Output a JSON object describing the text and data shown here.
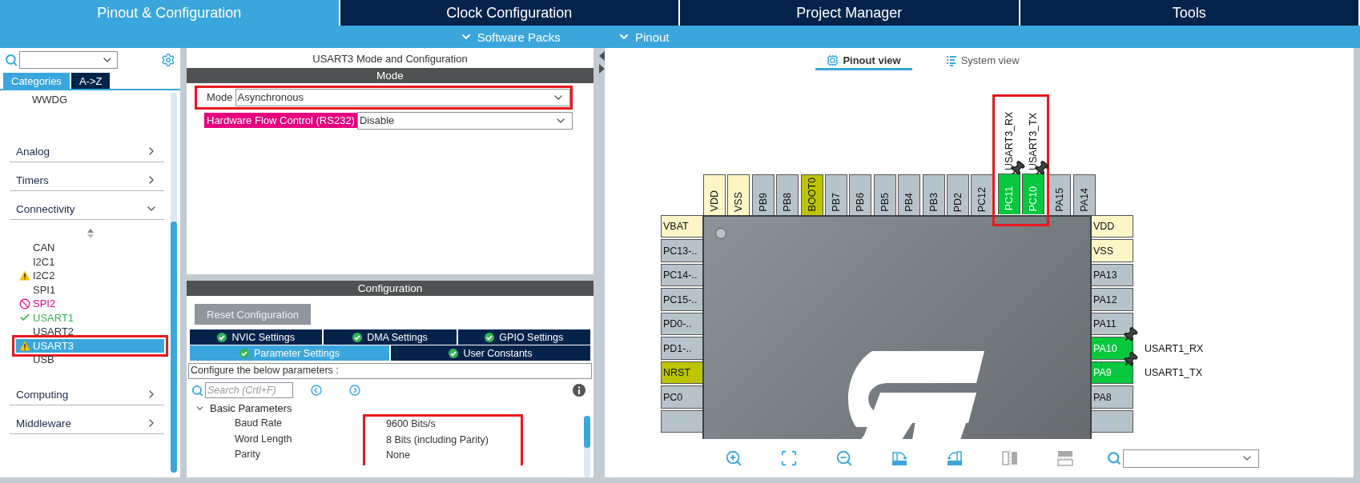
{
  "main_tabs": [
    {
      "label": "Pinout & Configuration",
      "selected": true
    },
    {
      "label": "Clock Configuration",
      "selected": false
    },
    {
      "label": "Project Manager",
      "selected": false
    },
    {
      "label": "Tools",
      "selected": false
    }
  ],
  "sub_menus": [
    "Software Packs",
    "Pinout"
  ],
  "sidebar": {
    "tabs": [
      {
        "label": "Categories",
        "selected": true
      },
      {
        "label": "A->Z",
        "selected": false
      }
    ],
    "top_items": [
      "WWDG"
    ],
    "categories": [
      {
        "label": "Analog",
        "expanded": false
      },
      {
        "label": "Timers",
        "expanded": false
      },
      {
        "label": "Connectivity",
        "expanded": true,
        "children": [
          {
            "label": "CAN",
            "kind": "plain",
            "selected": false,
            "annotated": false
          },
          {
            "label": "I2C1",
            "kind": "plain",
            "selected": false,
            "annotated": false
          },
          {
            "label": "I2C2",
            "kind": "warning",
            "selected": false,
            "annotated": false
          },
          {
            "label": "SPI1",
            "kind": "plain",
            "selected": false,
            "annotated": false
          },
          {
            "label": "SPI2",
            "kind": "error",
            "selected": false,
            "annotated": false
          },
          {
            "label": "USART1",
            "kind": "ok",
            "selected": false,
            "annotated": false
          },
          {
            "label": "USART2",
            "kind": "plain",
            "selected": false,
            "annotated": false
          },
          {
            "label": "USART3",
            "kind": "warning",
            "selected": true,
            "annotated": true
          },
          {
            "label": "USB",
            "kind": "plain",
            "selected": false,
            "annotated": false
          }
        ]
      },
      {
        "label": "Computing",
        "expanded": false
      },
      {
        "label": "Middleware",
        "expanded": false
      }
    ]
  },
  "mode_panel": {
    "title": "USART3 Mode and Configuration",
    "header": "Mode",
    "fields": [
      {
        "label": "Mode",
        "value": "Asynchronous",
        "flagged": false,
        "annotated": true
      },
      {
        "label": "Hardware Flow Control (RS232)",
        "value": "Disable",
        "flagged": true
      }
    ]
  },
  "config_panel": {
    "header": "Configuration",
    "reset_button": {
      "label": "Reset Configuration",
      "disabled": true
    },
    "tab_rows": [
      [
        {
          "label": "NVIC Settings",
          "selected": false
        },
        {
          "label": "DMA Settings",
          "selected": false
        },
        {
          "label": "GPIO Settings",
          "selected": false
        }
      ],
      [
        {
          "label": "Parameter Settings",
          "selected": true
        },
        {
          "label": "User Constants",
          "selected": false
        }
      ]
    ],
    "hint": "Configure the below parameters :",
    "search": {
      "placeholder": "Search (Crtl+F)"
    },
    "groups": [
      {
        "label": "Basic Parameters",
        "expanded": true,
        "values_annotated": true,
        "params": [
          {
            "name": "Baud Rate",
            "value": "9600 Bits/s"
          },
          {
            "name": "Word Length",
            "value": "8 Bits (including Parity)"
          },
          {
            "name": "Parity",
            "value": "None"
          }
        ]
      }
    ]
  },
  "view_tabs": [
    {
      "label": "Pinout view",
      "selected": true
    },
    {
      "label": "System view",
      "selected": false
    }
  ],
  "chip": {
    "top_annotated": true,
    "top_pins": [
      {
        "label": "VDD",
        "kind": "power"
      },
      {
        "label": "VSS",
        "kind": "power"
      },
      {
        "label": "PB9",
        "kind": "io"
      },
      {
        "label": "PB8",
        "kind": "io"
      },
      {
        "label": "BOOT0",
        "kind": "boot"
      },
      {
        "label": "PB7",
        "kind": "io"
      },
      {
        "label": "PB6",
        "kind": "io"
      },
      {
        "label": "PB5",
        "kind": "io"
      },
      {
        "label": "PB4",
        "kind": "io"
      },
      {
        "label": "PB3",
        "kind": "io"
      },
      {
        "label": "PD2",
        "kind": "io"
      },
      {
        "label": "PC12",
        "kind": "io"
      },
      {
        "label": "PC11",
        "kind": "assigned",
        "signal": "USART3_RX"
      },
      {
        "label": "PC10",
        "kind": "assigned",
        "signal": "USART3_TX"
      },
      {
        "label": "PA15",
        "kind": "io"
      },
      {
        "label": "PA14",
        "kind": "io"
      }
    ],
    "left_pins": [
      {
        "label": "VBAT",
        "kind": "power"
      },
      {
        "label": "PC13-..",
        "kind": "io"
      },
      {
        "label": "PC14-..",
        "kind": "io"
      },
      {
        "label": "PC15-..",
        "kind": "io"
      },
      {
        "label": "PD0-..",
        "kind": "io"
      },
      {
        "label": "PD1-..",
        "kind": "io"
      },
      {
        "label": "NRST",
        "kind": "boot"
      },
      {
        "label": "PC0",
        "kind": "io"
      },
      {
        "kind": "io"
      }
    ],
    "right_pins": [
      {
        "label": "VDD",
        "kind": "power"
      },
      {
        "label": "VSS",
        "kind": "power"
      },
      {
        "label": "PA13",
        "kind": "io"
      },
      {
        "label": "PA12",
        "kind": "io"
      },
      {
        "label": "PA11",
        "kind": "io"
      },
      {
        "label": "PA10",
        "kind": "assigned",
        "signal": "USART1_RX"
      },
      {
        "label": "PA9",
        "kind": "assigned",
        "signal": "USART1_TX"
      },
      {
        "label": "PA8",
        "kind": "io"
      },
      {
        "kind": "io"
      }
    ]
  },
  "toolbar": [
    {
      "kind": "zoom-in",
      "disabled": false
    },
    {
      "kind": "fit",
      "disabled": false
    },
    {
      "kind": "zoom-out",
      "disabled": false
    },
    {
      "kind": "rotate-right",
      "disabled": false
    },
    {
      "kind": "rotate-left",
      "disabled": false
    },
    {
      "kind": "flip-horizontal",
      "disabled": true
    },
    {
      "kind": "flip-vertical",
      "disabled": true
    }
  ]
}
